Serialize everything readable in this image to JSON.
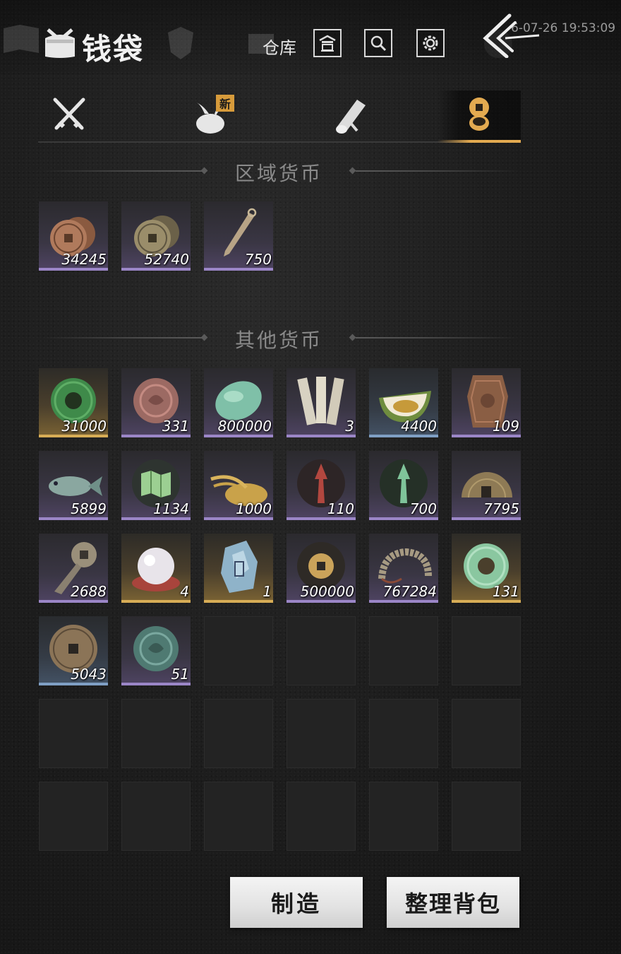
{
  "header": {
    "title": "钱袋",
    "warehouse_label": "仓库",
    "timestamp": "6-07-26 19:53:09",
    "icons": [
      "bag-icon",
      "warehouse-icon",
      "search-icon",
      "gear-icon",
      "back-arrow-icon"
    ]
  },
  "tabs": [
    {
      "name": "weapons",
      "icon": "crossed-swords-icon",
      "active": false
    },
    {
      "name": "items",
      "icon": "bundle-icon",
      "active": false,
      "badge": "新"
    },
    {
      "name": "scrolls",
      "icon": "scroll-icon",
      "active": false
    },
    {
      "name": "currency",
      "icon": "coins-icon",
      "active": true
    }
  ],
  "sections": {
    "regional_title": "区域货币",
    "other_title": "其他货币"
  },
  "regional_items": [
    {
      "icon": "copper-coins-icon",
      "count": "34245",
      "rarity": "purple"
    },
    {
      "icon": "bronze-coins-icon",
      "count": "52740",
      "rarity": "purple"
    },
    {
      "icon": "throwing-knife-icon",
      "count": "750",
      "rarity": "purple"
    }
  ],
  "other_items": [
    {
      "icon": "green-jade-disc-icon",
      "count": "31000",
      "rarity": "gold"
    },
    {
      "icon": "red-stone-token-icon",
      "count": "331",
      "rarity": "purple"
    },
    {
      "icon": "jade-pebble-icon",
      "count": "800000",
      "rarity": "purple"
    },
    {
      "icon": "bamboo-slips-icon",
      "count": "3",
      "rarity": "purple"
    },
    {
      "icon": "melon-icon",
      "count": "4400",
      "rarity": "blue"
    },
    {
      "icon": "bronze-tablet-icon",
      "count": "109",
      "rarity": "purple"
    },
    {
      "icon": "fish-icon",
      "count": "5899",
      "rarity": "purple"
    },
    {
      "icon": "map-icon",
      "count": "1134",
      "rarity": "purple"
    },
    {
      "icon": "grain-pile-icon",
      "count": "1000",
      "rarity": "purple"
    },
    {
      "icon": "red-emblem-icon",
      "count": "110",
      "rarity": "purple"
    },
    {
      "icon": "green-emblem-icon",
      "count": "700",
      "rarity": "purple"
    },
    {
      "icon": "half-coin-icon",
      "count": "7795",
      "rarity": "purple"
    },
    {
      "icon": "key-coin-icon",
      "count": "2688",
      "rarity": "purple"
    },
    {
      "icon": "pearl-icon",
      "count": "4",
      "rarity": "gold"
    },
    {
      "icon": "crystal-icon",
      "count": "1",
      "rarity": "gold"
    },
    {
      "icon": "gold-coin-emblem-icon",
      "count": "500000",
      "rarity": "purple"
    },
    {
      "icon": "coin-string-icon",
      "count": "767284",
      "rarity": "purple"
    },
    {
      "icon": "pale-jade-disc-icon",
      "count": "131",
      "rarity": "gold"
    },
    {
      "icon": "ancient-coin-icon",
      "count": "5043",
      "rarity": "blue"
    },
    {
      "icon": "teal-stone-token-icon",
      "count": "51",
      "rarity": "purple"
    }
  ],
  "empty_slot_count": 16,
  "buttons": {
    "craft": "制造",
    "sort_bag": "整理背包"
  },
  "colors": {
    "accent_gold": "#e3aa50",
    "rarity_purple": "#9b86c7",
    "rarity_gold": "#d7ad56",
    "rarity_blue": "#7f9fc4"
  }
}
